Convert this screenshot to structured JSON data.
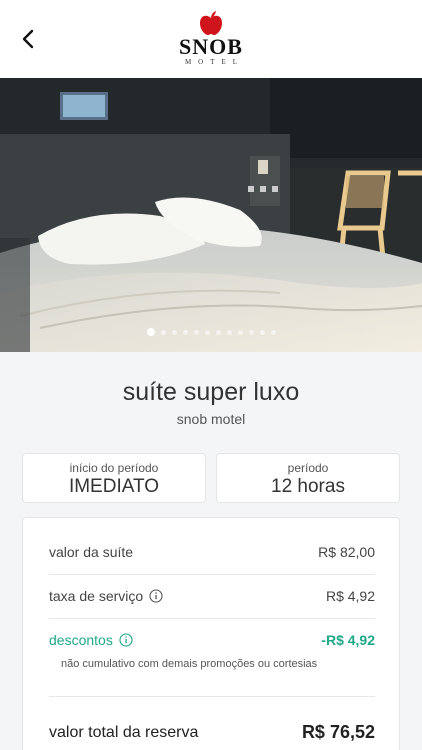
{
  "header": {
    "logo_text": "SNOB",
    "logo_sub": "MOTEL",
    "back_icon": "chevron-left-icon"
  },
  "gallery": {
    "total_images": 12,
    "active_index": 0
  },
  "suite": {
    "name": "suíte super luxo",
    "motel": "snob motel"
  },
  "period": {
    "start_label": "início do período",
    "start_value": "IMEDIATO",
    "duration_label": "período",
    "duration_value": "12 horas"
  },
  "summary": {
    "suite_value_label": "valor da suíte",
    "suite_value": "R$ 82,00",
    "service_fee_label": "taxa de serviço",
    "service_fee": "R$ 4,92",
    "discounts_label": "descontos",
    "discounts": "-R$ 4,92",
    "discount_note": "não cumulativo com demais promoções ou cortesias",
    "total_label": "valor total da reserva",
    "total": "R$ 76,52"
  },
  "colors": {
    "accent_green": "#1ea88a",
    "logo_red": "#d0141c"
  }
}
